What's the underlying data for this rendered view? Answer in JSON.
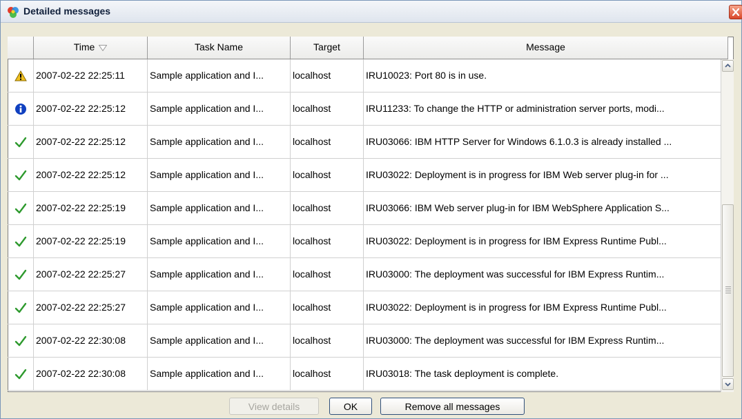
{
  "window": {
    "title": "Detailed messages"
  },
  "table": {
    "columns": [
      "",
      "Time",
      "Task Name",
      "Target",
      "Message"
    ],
    "rows": [
      {
        "status": "warning",
        "time": "2007-02-22 22:25:11",
        "task": "Sample application and I...",
        "target": "localhost",
        "message": "IRU10023: Port 80 is in use."
      },
      {
        "status": "info",
        "time": "2007-02-22 22:25:12",
        "task": "Sample application and I...",
        "target": "localhost",
        "message": "IRU11233: To change the HTTP or administration server ports, modi..."
      },
      {
        "status": "success",
        "time": "2007-02-22 22:25:12",
        "task": "Sample application and I...",
        "target": "localhost",
        "message": "IRU03066: IBM HTTP Server for Windows 6.1.0.3 is already installed ..."
      },
      {
        "status": "success",
        "time": "2007-02-22 22:25:12",
        "task": "Sample application and I...",
        "target": "localhost",
        "message": "IRU03022: Deployment is in progress for IBM Web server plug-in for ..."
      },
      {
        "status": "success",
        "time": "2007-02-22 22:25:19",
        "task": "Sample application and I...",
        "target": "localhost",
        "message": "IRU03066: IBM Web server plug-in for IBM WebSphere Application S..."
      },
      {
        "status": "success",
        "time": "2007-02-22 22:25:19",
        "task": "Sample application and I...",
        "target": "localhost",
        "message": "IRU03022: Deployment is in progress for IBM Express Runtime Publ..."
      },
      {
        "status": "success",
        "time": "2007-02-22 22:25:27",
        "task": "Sample application and I...",
        "target": "localhost",
        "message": "IRU03000: The deployment was successful for IBM Express Runtim..."
      },
      {
        "status": "success",
        "time": "2007-02-22 22:25:27",
        "task": "Sample application and I...",
        "target": "localhost",
        "message": "IRU03022: Deployment is in progress for IBM Express Runtime Publ..."
      },
      {
        "status": "success",
        "time": "2007-02-22 22:30:08",
        "task": "Sample application and I...",
        "target": "localhost",
        "message": "IRU03000: The deployment was successful for IBM Express Runtim..."
      },
      {
        "status": "success",
        "time": "2007-02-22 22:30:08",
        "task": "Sample application and I...",
        "target": "localhost",
        "message": "IRU03018: The task deployment is complete."
      }
    ]
  },
  "buttons": {
    "view_details": "View details",
    "ok": "OK",
    "remove_all": "Remove all messages"
  },
  "colors": {
    "success": "#2e9a2e",
    "info": "#1040c0",
    "warning": "#f0c020"
  },
  "icons": {
    "app": "app-logo-icon",
    "close": "close-icon",
    "sort": "sort-descending-icon",
    "warning": "warning-icon",
    "info": "info-icon",
    "success": "checkmark-icon"
  }
}
